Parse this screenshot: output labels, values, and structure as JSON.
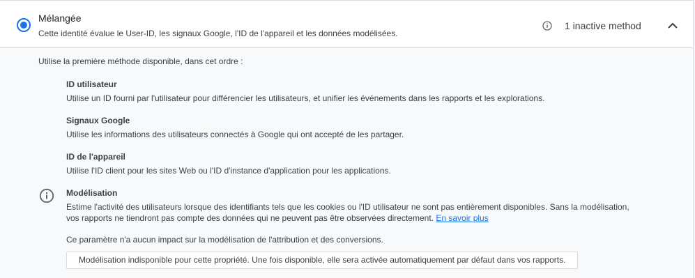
{
  "option": {
    "title": "Mélangée",
    "description": "Cette identité évalue le User-ID, les signaux Google, l'ID de l'appareil et les données modélisées.",
    "inactive_label": "1 inactive method",
    "selected": true
  },
  "intro": "Utilise la première méthode disponible, dans cet ordre :",
  "methods": [
    {
      "title": "ID utilisateur",
      "description": "Utilise un ID fourni par l'utilisateur pour différencier les utilisateurs, et unifier les événements dans les rapports et les explorations."
    },
    {
      "title": "Signaux Google",
      "description": "Utilise les informations des utilisateurs connectés à Google qui ont accepté de les partager."
    },
    {
      "title": "ID de l'appareil",
      "description": "Utilise l'ID client pour les sites Web ou l'ID d'instance d'application pour les applications."
    },
    {
      "title": "Modélisation",
      "description": "Estime l'activité des utilisateurs lorsque des identifiants tels que les cookies ou l'ID utilisateur ne sont pas entièrement disponibles. Sans la modélisation, vos rapports ne tiendront pas compte des données qui ne peuvent pas être observées directement.",
      "link": "En savoir plus"
    }
  ],
  "note": "Ce paramètre n'a aucun impact sur la modélisation de l'attribution et des conversions.",
  "notice": "Modélisation indisponible pour cette propriété. Une fois disponible, elle sera activée automatiquement par défaut dans vos rapports.",
  "colors": {
    "accent": "#1a73e8",
    "text": "#3c4043",
    "border": "#dadce0",
    "panel_bg": "#f8f9fa"
  },
  "icons": {
    "inactive": "info-icon",
    "expand": "chevron-up-icon",
    "modeling": "info-icon"
  }
}
